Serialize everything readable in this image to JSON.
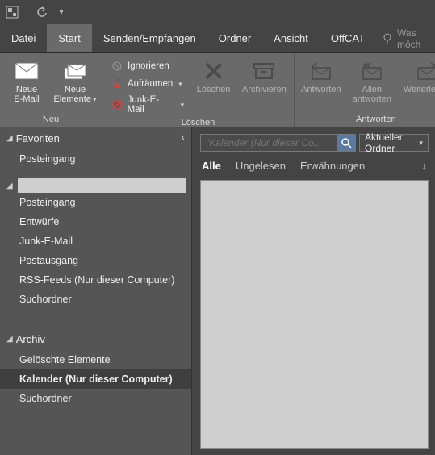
{
  "titlebar": {
    "app_icon": "outlook-icon",
    "undo_icon": "undo-icon",
    "qat_dropdown": "▾"
  },
  "tabs": {
    "datei": "Datei",
    "start": "Start",
    "senden": "Senden/Empfangen",
    "ordner": "Ordner",
    "ansicht": "Ansicht",
    "offcat": "OffCAT",
    "tellme": "Was möch"
  },
  "ribbon": {
    "neu": {
      "label": "Neu",
      "neue_email": "Neue\nE-Mail",
      "neue_elemente": "Neue\nElemente"
    },
    "loeschen": {
      "label": "Löschen",
      "ignorieren": "Ignorieren",
      "aufraeumen": "Aufräumen",
      "junk": "Junk-E-Mail",
      "loeschen_btn": "Löschen",
      "archivieren": "Archivieren"
    },
    "antworten": {
      "label": "Antworten",
      "antworten_btn": "Antworten",
      "allen": "Allen\nantworten",
      "weiterleiten": "Weiterleiten"
    }
  },
  "nav": {
    "favoriten": "Favoriten",
    "fav_items": {
      "posteingang": "Posteingang"
    },
    "account_items": {
      "posteingang": "Posteingang",
      "entwuerfe": "Entwürfe",
      "junk": "Junk-E-Mail",
      "postausgang": "Postausgang",
      "rss": "RSS-Feeds (Nur dieser Computer)",
      "suchordner": "Suchordner"
    },
    "archiv": "Archiv",
    "archiv_items": {
      "geloescht": "Gelöschte Elemente",
      "kalender": "Kalender (Nur dieser Computer)",
      "suchordner": "Suchordner"
    }
  },
  "search": {
    "placeholder": "\"Kalender (Nur dieser Co...",
    "scope": "Aktueller Ordner"
  },
  "filters": {
    "alle": "Alle",
    "ungelesen": "Ungelesen",
    "erwaehnungen": "Erwähnungen",
    "sort_arrow": "↓"
  }
}
